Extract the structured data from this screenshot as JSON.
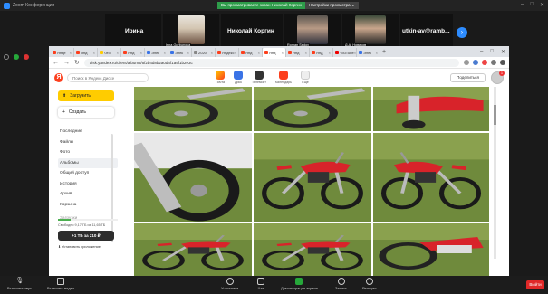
{
  "zoom": {
    "window_title": "Zoom Конференция",
    "share_banner": "Вы просматриваете экран Николай Коргин",
    "view_options": "Настройки просмотра ⌄",
    "participants": [
      {
        "name": "Ирина",
        "caption": ""
      },
      {
        "name": "",
        "caption": "Irina Gorbunova"
      },
      {
        "name": "Николай Коргин",
        "caption": ""
      },
      {
        "name": "",
        "caption": "Roman Sedov"
      },
      {
        "name": "",
        "caption": "Д.А. Новиков"
      },
      {
        "name": "utkin-av@ramb...",
        "caption": ""
      }
    ],
    "toolbar": {
      "audio": "Включить звук",
      "video": "Включить видео",
      "participants": "Участники",
      "chat": "Чат",
      "share": "Демонстрация экрана",
      "record": "Запись",
      "reactions": "Реакции",
      "leave": "Выйти"
    }
  },
  "browser": {
    "tabs": [
      "Янде",
      "Янд",
      "Что",
      "Янд",
      "Элек",
      "Элек",
      "2020",
      "Яндекс",
      "Янд",
      "Янд",
      "Янд",
      "Янд",
      "YouTube",
      "Элек"
    ],
    "active_tab": 9,
    "url": "disk.yandex.ru/client/albums/6f2b4d8b2a0d4f1a9f1b2e3c"
  },
  "disk": {
    "search_placeholder": "Поиск в Яндекс Диске",
    "apps": [
      "Почта",
      "Диск",
      "Телемост",
      "Календарь",
      "Ещё"
    ],
    "share_button": "Поделиться",
    "notifications": "1",
    "upload": "Загрузить",
    "create": "Создать",
    "nav": [
      "Последние",
      "Файлы",
      "Фото",
      "Альбомы",
      "Общий доступ",
      "История",
      "Архив",
      "Корзина",
      "Загрузки"
    ],
    "active_nav": 3,
    "storage_text": "Свободно 9,17 ГБ из 11,65 ГБ",
    "storage_used": 0.21,
    "buy_button": "+1 ТБ за 210 ₽",
    "install_app": "Установить приложение"
  },
  "colors": {
    "yandex_red": "#fc3f1d",
    "yandex_yellow": "#ffcc00",
    "zoom_blue": "#2d8cff",
    "share_green": "#2e9c4a",
    "leave_red": "#e02828"
  }
}
